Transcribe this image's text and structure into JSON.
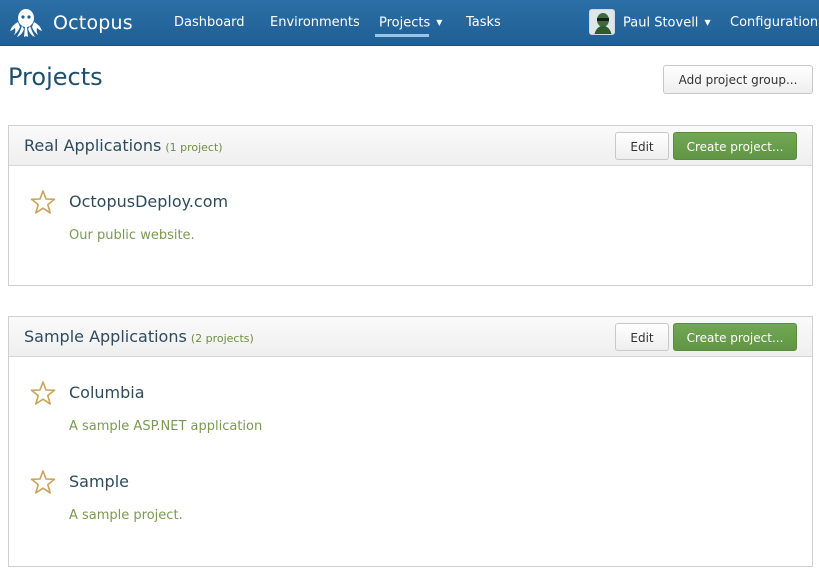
{
  "app": {
    "name": "Octopus"
  },
  "nav": {
    "items": [
      {
        "label": "Dashboard"
      },
      {
        "label": "Environments"
      },
      {
        "label": "Projects",
        "active": true
      },
      {
        "label": "Tasks"
      }
    ],
    "user": {
      "name": "Paul Stovell"
    },
    "configuration": "Configuration"
  },
  "page": {
    "title": "Projects",
    "add_group_label": "Add project group..."
  },
  "groups": [
    {
      "name": "Real Applications",
      "count_label": "(1 project)",
      "edit_label": "Edit",
      "create_label": "Create project...",
      "projects": [
        {
          "name": "OctopusDeploy.com",
          "description": "Our public website."
        }
      ]
    },
    {
      "name": "Sample Applications",
      "count_label": "(2 projects)",
      "edit_label": "Edit",
      "create_label": "Create project...",
      "projects": [
        {
          "name": "Columbia",
          "description": "A sample ASP.NET application"
        },
        {
          "name": "Sample",
          "description": "A sample project."
        }
      ]
    }
  ],
  "colors": {
    "topbar": "#1f5f95",
    "title": "#1e4f6f",
    "primary_button": "#62994a",
    "description": "#7a9a52",
    "star": "#c8a35a"
  }
}
